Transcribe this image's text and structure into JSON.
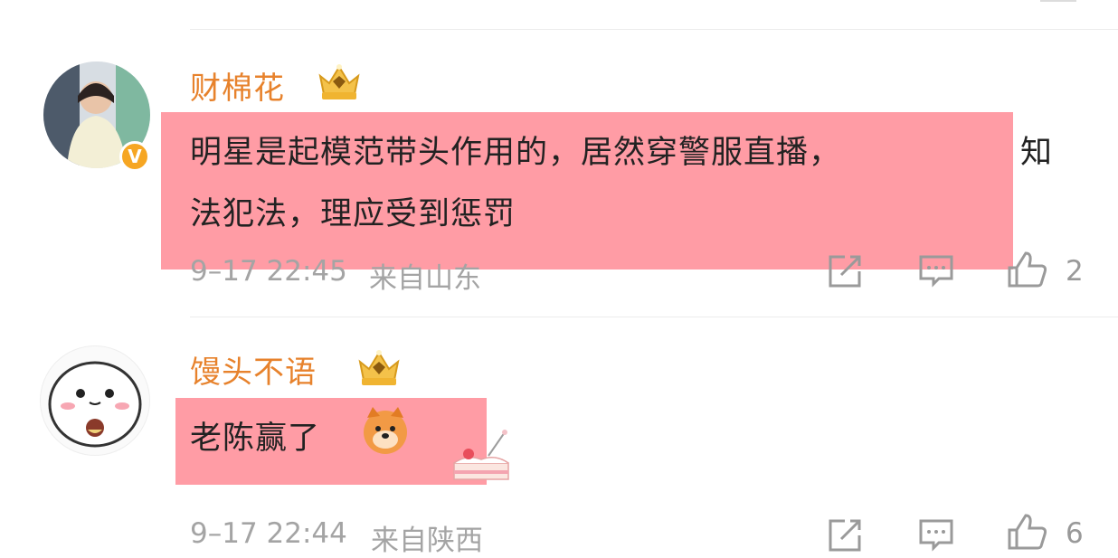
{
  "comments": [
    {
      "username": "财棉花",
      "badge": "V",
      "text_lines": [
        "明星是起模范带头作用的，居然穿警服直播，",
        "知",
        "法犯法，理应受到惩罚"
      ],
      "timestamp": "9–17 22:45",
      "location": "来自山东",
      "likes": "2"
    },
    {
      "username": "馒头不语",
      "text_lines": [
        "老陈赢了"
      ],
      "timestamp": "9–17 22:44",
      "location": "来自陕西",
      "likes": "6"
    }
  ],
  "colors": {
    "username": "#e7822c",
    "highlight": "#ff808c",
    "meta": "#a4a4a4",
    "badge": "#f6a623"
  },
  "icons": [
    "crown-badge-icon",
    "share-icon",
    "comment-icon",
    "like-icon",
    "doge-emoji-icon",
    "cake-sticker-icon"
  ]
}
